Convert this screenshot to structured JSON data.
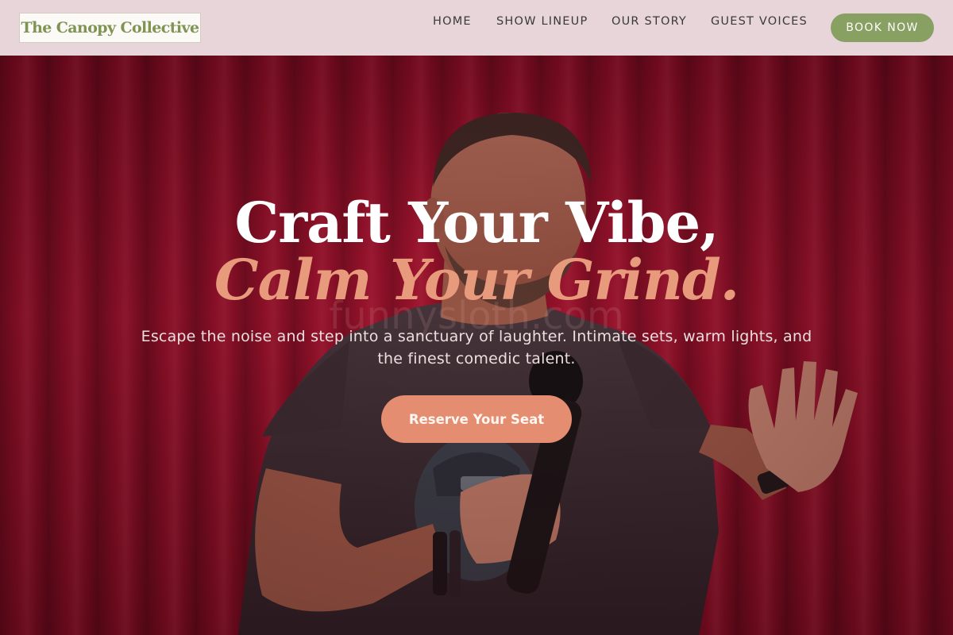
{
  "header": {
    "logo_text": "The Canopy Collective",
    "nav": [
      {
        "label": "HOME"
      },
      {
        "label": "SHOW LINEUP"
      },
      {
        "label": "OUR STORY"
      },
      {
        "label": "GUEST VOICES"
      }
    ],
    "cta_label": "BOOK NOW"
  },
  "hero": {
    "headline_line1": "Craft Your Vibe,",
    "headline_line2": "Calm Your Grind.",
    "watermark": "funnysloth.com",
    "subtitle": "Escape the noise and step into a sanctuary of laughter. Intimate sets, warm lights, and the finest comedic talent.",
    "cta_label": "Reserve Your Seat",
    "image": "comedian-on-stage-photo"
  },
  "colors": {
    "header_bg": "#e8d5d9",
    "brand_green": "#88a062",
    "logo_green": "#7f9352",
    "accent_salmon": "#e58d70",
    "curtain_red": "#a5142f"
  },
  "icons": {
    "photo": "comedian-on-stage-photo"
  }
}
